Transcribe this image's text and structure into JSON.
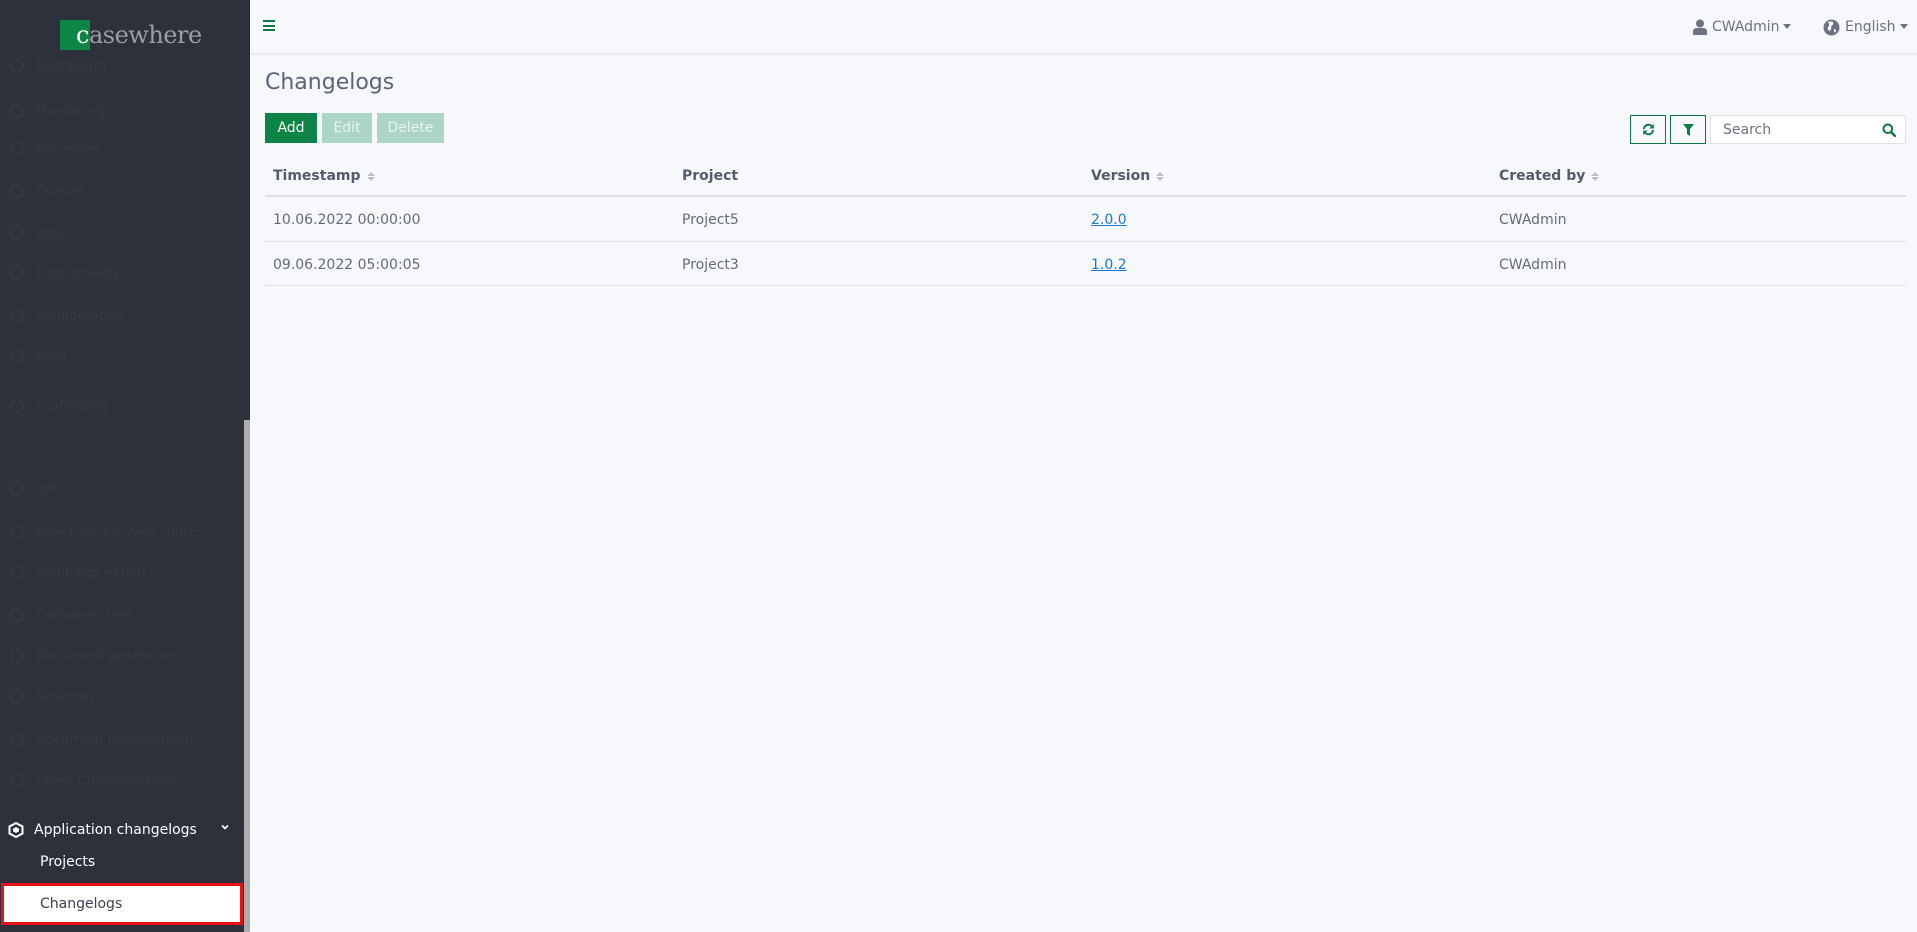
{
  "brand": {
    "logo_first": "c",
    "logo_rest": "asewhere",
    "accent": "#0d8544"
  },
  "sidebar": {
    "ghost_items": [
      "Dashboard",
      "Monitoring",
      "Processes",
      "Queues",
      "Jobs",
      "Functionality",
      "Configuration",
      "Data",
      "Scaffolding",
      "IdP",
      "Role-based access control",
      "Audit logs export",
      "Consumer test",
      "Document generation",
      "Schemes",
      "Document management",
      "Client Customizations..."
    ],
    "group": {
      "label": "Application changelogs",
      "icon": "cube-icon",
      "expanded": true
    },
    "items": [
      {
        "label": "Projects",
        "active": false
      },
      {
        "label": "Changelogs",
        "active": true
      }
    ]
  },
  "header": {
    "menu_icon": "hamburger-icon",
    "user": {
      "label": "CWAdmin",
      "icon": "user-icon"
    },
    "language": {
      "label": "English",
      "icon": "globe-icon"
    }
  },
  "main": {
    "title": "Changelogs",
    "toolbar": {
      "add_label": "Add",
      "edit_label": "Edit",
      "delete_label": "Delete",
      "refresh_icon": "refresh-icon",
      "filter_icon": "filter-icon",
      "search_placeholder": "Search",
      "search_value": ""
    },
    "table": {
      "columns": [
        {
          "label": "Timestamp",
          "sortable": true
        },
        {
          "label": "Project",
          "sortable": false
        },
        {
          "label": "Version",
          "sortable": true
        },
        {
          "label": "Created by",
          "sortable": true
        }
      ],
      "rows": [
        {
          "timestamp": "10.06.2022 00:00:00",
          "project": "Project5",
          "version": "2.0.0",
          "created_by": "CWAdmin"
        },
        {
          "timestamp": "09.06.2022 05:00:05",
          "project": "Project3",
          "version": "1.0.2",
          "created_by": "CWAdmin"
        }
      ]
    }
  }
}
